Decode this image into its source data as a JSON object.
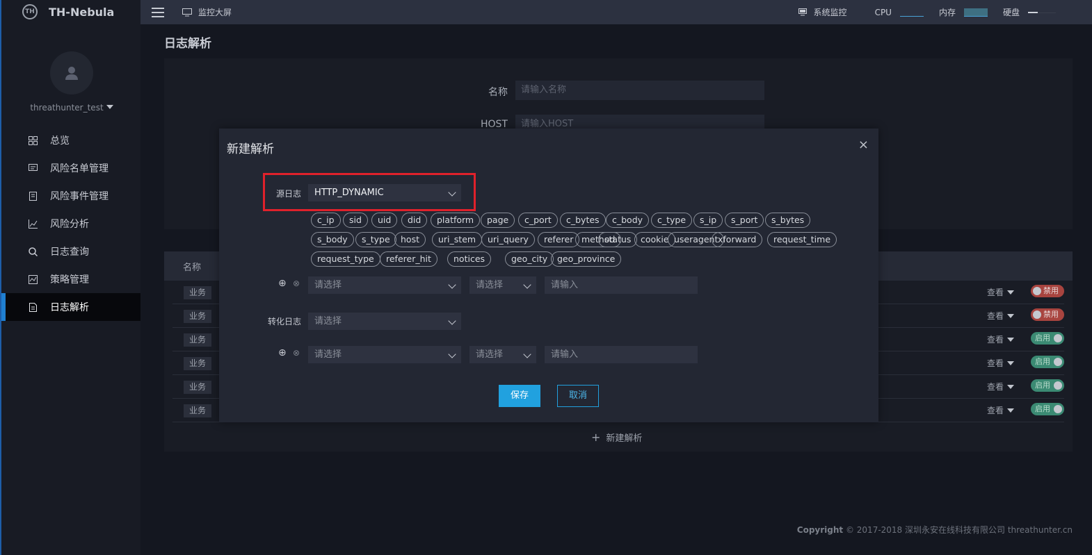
{
  "brand": {
    "name": "TH-Nebula",
    "logo_text": "TH"
  },
  "user": {
    "name": "threathunter_test"
  },
  "nav": {
    "items": [
      {
        "label": "总览",
        "icon": "grid-icon"
      },
      {
        "label": "风险名单管理",
        "icon": "list-card-icon"
      },
      {
        "label": "风险事件管理",
        "icon": "document-icon"
      },
      {
        "label": "风险分析",
        "icon": "chart-line-icon"
      },
      {
        "label": "日志查询",
        "icon": "search-icon"
      },
      {
        "label": "策略管理",
        "icon": "strategy-icon"
      },
      {
        "label": "日志解析",
        "icon": "file-icon"
      }
    ],
    "active_index": 6
  },
  "topbar": {
    "monitor_label": "监控大屏",
    "sysmon_label": "系统监控",
    "cpu_label": "CPU",
    "mem_label": "内存",
    "disk_label": "硬盘"
  },
  "page": {
    "title": "日志解析",
    "filter": {
      "name_label": "名称",
      "name_placeholder": "请输入名称",
      "host_label": "HOST",
      "host_placeholder": "请输入HOST"
    },
    "table": {
      "header_name": "名称",
      "rows": [
        {
          "tag": "业务",
          "view": "查看",
          "status": "禁用"
        },
        {
          "tag": "业务",
          "view": "查看",
          "status": "禁用"
        },
        {
          "tag": "业务",
          "view": "查看",
          "status": "启用"
        },
        {
          "tag": "业务",
          "view": "查看",
          "status": "启用"
        },
        {
          "tag": "业务",
          "view": "查看",
          "status": "启用"
        },
        {
          "tag": "业务",
          "view": "查看",
          "status": "启用"
        }
      ],
      "add_label": "新建解析"
    },
    "copyright_prefix": "Copyright",
    "copyright_text": "© 2017-2018 深圳永安在线科技有限公司 threathunter.cn"
  },
  "modal": {
    "title": "新建解析",
    "close_glyph": "×",
    "source_label": "源日志",
    "source_value": "HTTP_DYNAMIC",
    "fields": [
      "c_ip",
      "sid",
      "uid",
      "did",
      "platform",
      "page",
      "c_port",
      "c_bytes",
      "c_body",
      "c_type",
      "s_ip",
      "s_port",
      "s_bytes",
      "s_body",
      "s_type",
      "host",
      "uri_stem",
      "uri_query",
      "referer",
      "method",
      "status",
      "cookie",
      "useragent",
      "xforward",
      "request_time",
      "request_type",
      "referer_hit",
      "notices",
      "geo_city",
      "geo_province"
    ],
    "condition1": {
      "field_placeholder": "请选择",
      "op_placeholder": "请选择",
      "value_placeholder": "请输入"
    },
    "target_label": "转化日志",
    "target_placeholder": "请选择",
    "condition2": {
      "field_placeholder": "请选择",
      "op_placeholder": "请选择",
      "value_placeholder": "请输入"
    },
    "save_label": "保存",
    "cancel_label": "取消"
  },
  "colors": {
    "accent": "#21a1df",
    "highlight": "#e0212b",
    "disabled": "#a8443f",
    "enabled": "#3b8a73"
  }
}
